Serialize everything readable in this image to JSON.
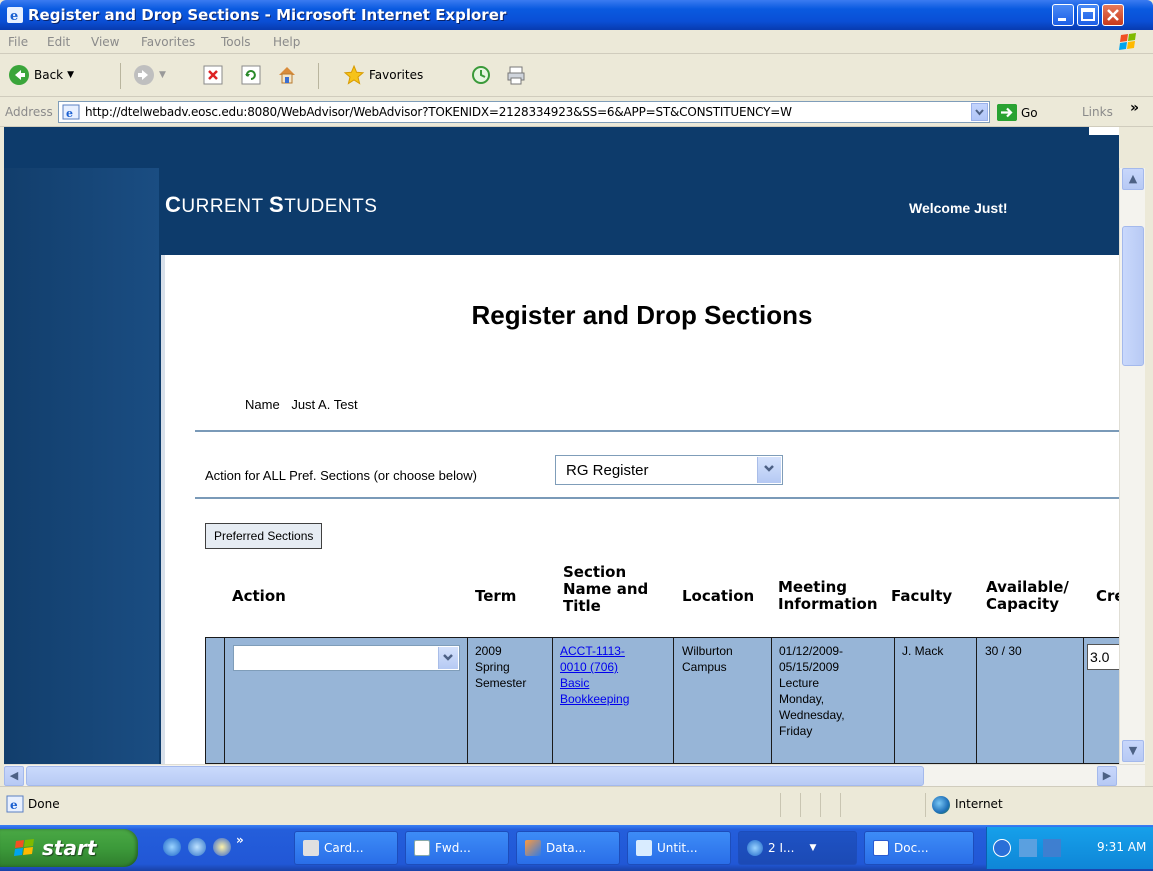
{
  "window": {
    "title": "Register and Drop Sections - Microsoft Internet Explorer"
  },
  "menu": [
    "File",
    "Edit",
    "View",
    "Favorites",
    "Tools",
    "Help"
  ],
  "toolbar": {
    "back_label": "Back",
    "favorites_label": "Favorites"
  },
  "address": {
    "label": "Address",
    "url": "http://dtelwebadv.eosc.edu:8080/WebAdvisor/WebAdvisor?TOKENIDX=2128334923&SS=6&APP=ST&CONSTITUENCY=W",
    "go_label": "Go",
    "links_label": "Links"
  },
  "page": {
    "banner_c": "C",
    "banner_urrent": "URRENT ",
    "banner_s": "S",
    "banner_tudents": "TUDENTS",
    "welcome": "Welcome Just!",
    "title": "Register and Drop Sections",
    "name_label": "Name",
    "name_value": "Just A. Test",
    "action_all_label": "Action for ALL Pref. Sections (or choose below)",
    "action_all_value": "RG Register",
    "preferred_button": "Preferred Sections"
  },
  "table": {
    "headers": {
      "action": "Action",
      "term": "Term",
      "section_1": "Section",
      "section_2": "Name and",
      "section_3": "Title",
      "location": "Location",
      "meeting_1": "Meeting",
      "meeting_2": "Information",
      "faculty": "Faculty",
      "capacity_1": "Available/",
      "capacity_2": "Capacity",
      "credits": "Cre"
    },
    "rows": [
      {
        "action": "",
        "term_1": "2009",
        "term_2": "Spring",
        "term_3": "Semester",
        "section_1": "ACCT-1113-",
        "section_2": "0010 (706)",
        "section_3": "Basic",
        "section_4": "Bookkeeping",
        "location_1": "Wilburton",
        "location_2": "Campus",
        "meeting_1": "01/12/2009-",
        "meeting_2": "05/15/2009",
        "meeting_3": "Lecture",
        "meeting_4": "Monday,",
        "meeting_5": "Wednesday,",
        "meeting_6": "Friday",
        "faculty": "J. Mack",
        "capacity": "30 / 30",
        "credits": "3.0"
      }
    ]
  },
  "status": {
    "text": "Done",
    "zone": "Internet"
  },
  "taskbar": {
    "start": "start",
    "tasks": [
      "Card...",
      "Fwd...",
      "Data...",
      "Untit...",
      "2 I...",
      "Doc..."
    ],
    "clock": "9:31 AM"
  },
  "colors": {
    "titlebar": "#0a4fd6",
    "banner": "#0d3b6b",
    "row_bg": "#97b5d7",
    "link": "#0000ee"
  }
}
